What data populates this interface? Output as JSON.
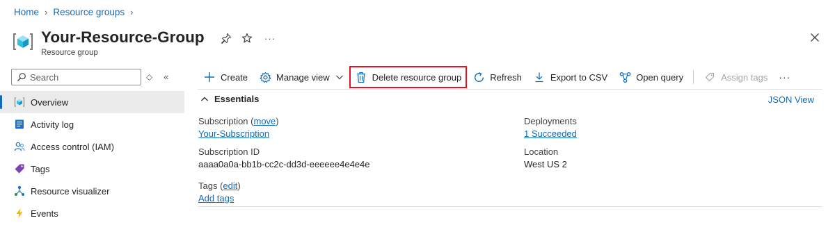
{
  "breadcrumb": {
    "home": "Home",
    "resource_groups": "Resource groups"
  },
  "header": {
    "title": "Your-Resource-Group",
    "subtitle": "Resource group",
    "more": "···"
  },
  "sidebar": {
    "search_placeholder": "Search",
    "items": [
      {
        "label": "Overview",
        "icon": "resource-group-icon",
        "active": true
      },
      {
        "label": "Activity log",
        "icon": "activity-log-icon"
      },
      {
        "label": "Access control (IAM)",
        "icon": "people-icon"
      },
      {
        "label": "Tags",
        "icon": "tag-icon"
      },
      {
        "label": "Resource visualizer",
        "icon": "visualizer-icon"
      },
      {
        "label": "Events",
        "icon": "lightning-icon"
      }
    ]
  },
  "toolbar": {
    "create": "Create",
    "manage_view": "Manage view",
    "delete": "Delete resource group",
    "refresh": "Refresh",
    "export": "Export to CSV",
    "open_query": "Open query",
    "assign_tags": "Assign tags",
    "more": "···"
  },
  "essentials": {
    "heading": "Essentials",
    "json_view": "JSON View",
    "subscription_label": "Subscription",
    "subscription_move": "move",
    "subscription_value": "Your-Subscription",
    "subscription_id_label": "Subscription ID",
    "subscription_id_value": "aaaa0a0a-bb1b-cc2c-dd3d-eeeeee4e4e4e",
    "tags_label": "Tags",
    "tags_edit": "edit",
    "tags_add": "Add tags",
    "deployments_label": "Deployments",
    "deployments_value": "1 Succeeded",
    "location_label": "Location",
    "location_value": "West US 2"
  },
  "colors": {
    "link": "#0f6cbd",
    "highlight": "#e81123",
    "active_bg": "#ebebeb"
  }
}
